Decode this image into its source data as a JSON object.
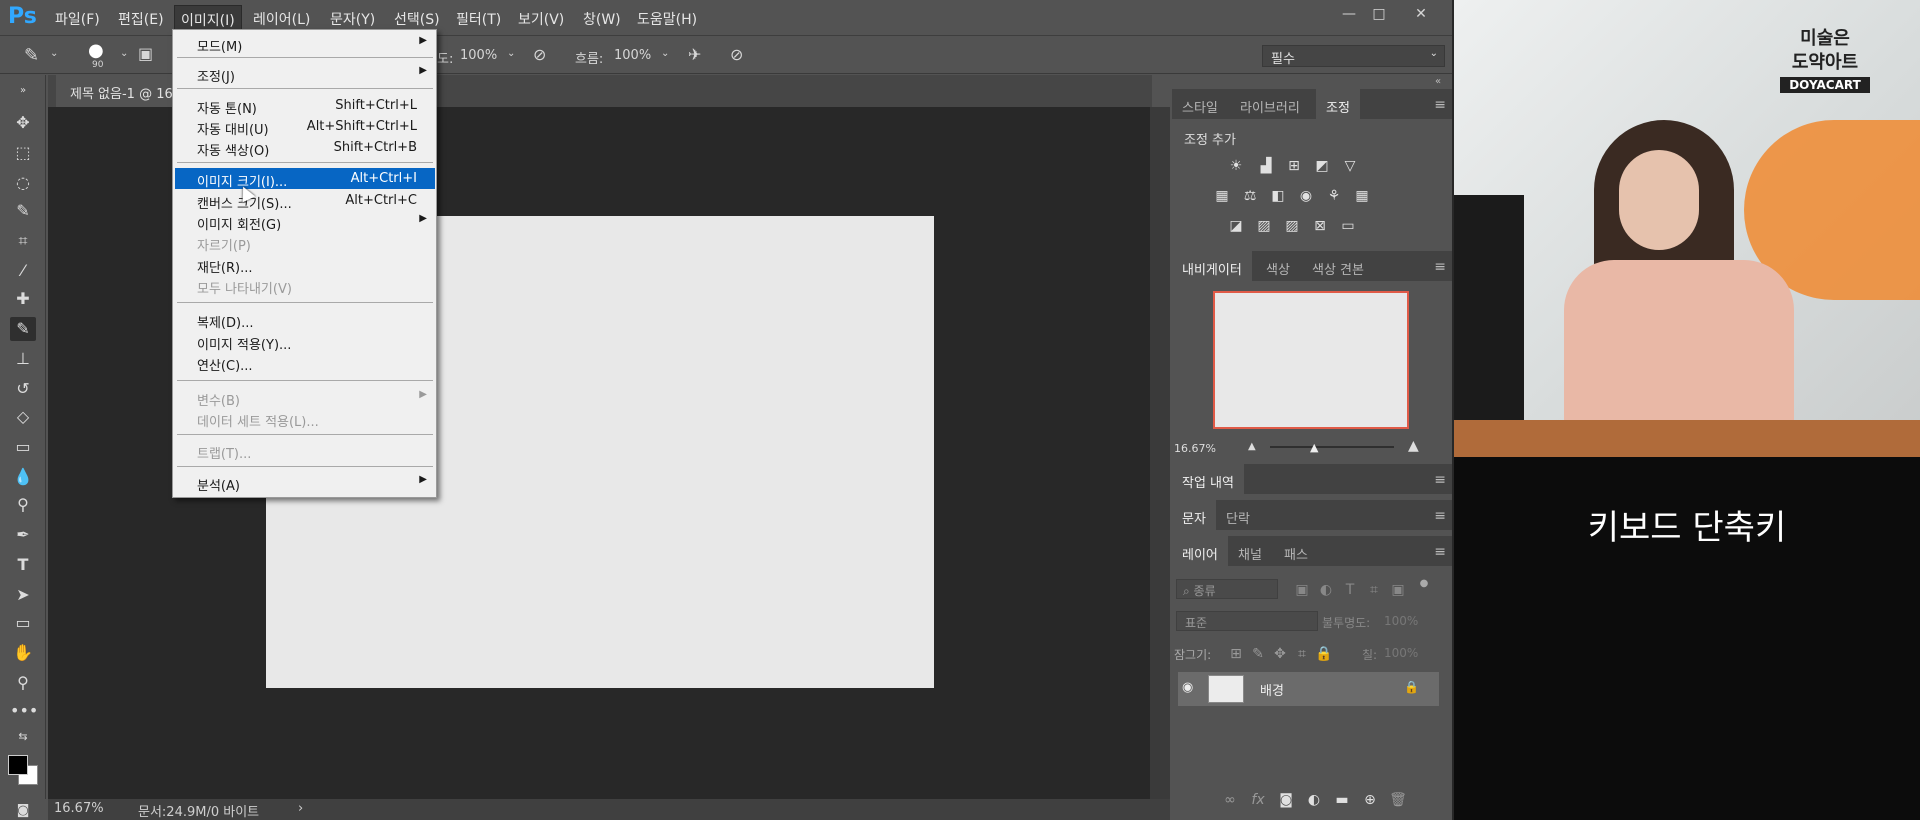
{
  "app": {
    "logo": "Ps"
  },
  "menubar": {
    "items": [
      "파일(F)",
      "편집(E)",
      "이미지(I)",
      "레이어(L)",
      "문자(Y)",
      "선택(S)",
      "필터(T)",
      "보기(V)",
      "창(W)",
      "도움말(H)"
    ],
    "window_buttons": {
      "minimize": "—",
      "restore": "□",
      "close": "✕"
    }
  },
  "options_bar": {
    "brush_size": "90",
    "opacity_label": "도:",
    "opacity_value": "100%",
    "flow_label": "흐름:",
    "flow_value": "100%",
    "preset": "필수"
  },
  "document": {
    "tab_title": "제목 없음-1 @ 16",
    "zoom": "16.67%",
    "doc_info": "문서:24.9M/0 바이트"
  },
  "image_menu": {
    "items": [
      {
        "label": "모드(M)",
        "shortcut": "",
        "submenu": true,
        "disabled": false
      },
      {
        "label": "조정(J)",
        "shortcut": "",
        "submenu": true,
        "disabled": false
      },
      {
        "label": "자동 톤(N)",
        "shortcut": "Shift+Ctrl+L",
        "submenu": false,
        "disabled": false
      },
      {
        "label": "자동 대비(U)",
        "shortcut": "Alt+Shift+Ctrl+L",
        "submenu": false,
        "disabled": false
      },
      {
        "label": "자동 색상(O)",
        "shortcut": "Shift+Ctrl+B",
        "submenu": false,
        "disabled": false
      },
      {
        "label": "이미지 크기(I)...",
        "shortcut": "Alt+Ctrl+I",
        "submenu": false,
        "disabled": false,
        "highlighted": true
      },
      {
        "label": "캔버스 크기(S)...",
        "shortcut": "Alt+Ctrl+C",
        "submenu": false,
        "disabled": false
      },
      {
        "label": "이미지 회전(G)",
        "shortcut": "",
        "submenu": true,
        "disabled": false
      },
      {
        "label": "자르기(P)",
        "shortcut": "",
        "submenu": false,
        "disabled": true
      },
      {
        "label": "재단(R)...",
        "shortcut": "",
        "submenu": false,
        "disabled": false
      },
      {
        "label": "모두 나타내기(V)",
        "shortcut": "",
        "submenu": false,
        "disabled": true
      },
      {
        "label": "복제(D)...",
        "shortcut": "",
        "submenu": false,
        "disabled": false
      },
      {
        "label": "이미지 적용(Y)...",
        "shortcut": "",
        "submenu": false,
        "disabled": false
      },
      {
        "label": "연산(C)...",
        "shortcut": "",
        "submenu": false,
        "disabled": false
      },
      {
        "label": "변수(B)",
        "shortcut": "",
        "submenu": true,
        "disabled": true
      },
      {
        "label": "데이터 세트 적용(L)...",
        "shortcut": "",
        "submenu": false,
        "disabled": true
      },
      {
        "label": "트랩(T)...",
        "shortcut": "",
        "submenu": false,
        "disabled": true
      },
      {
        "label": "분석(A)",
        "shortcut": "",
        "submenu": true,
        "disabled": false
      }
    ]
  },
  "panels": {
    "adjust_tabs": [
      "스타일",
      "라이브러리",
      "조정"
    ],
    "adjust_title": "조정 추가",
    "nav_tabs": [
      "내비게이터",
      "색상",
      "색상 견본"
    ],
    "nav_zoom": "16.67%",
    "history_tab": "작업 내역",
    "char_tabs": [
      "문자",
      "단락"
    ],
    "layer_tabs": [
      "레이어",
      "채널",
      "패스"
    ],
    "layer_filter": "종류",
    "blend_mode": "표준",
    "opacity_label": "불투명도:",
    "lock_label": "잠그기:",
    "fill_label": "칠:",
    "fill_value": "100%",
    "opacity_value": "100%",
    "layer_name": "배경"
  },
  "video": {
    "brand_line1": "미술은",
    "brand_line2": "도약아트",
    "brand_en": "DOYACART",
    "subtitle": "키보드 단축키"
  },
  "colors": {
    "highlight": "#0766c4",
    "ps_blue": "#31a8ff",
    "nav_frame": "#e05a47"
  }
}
